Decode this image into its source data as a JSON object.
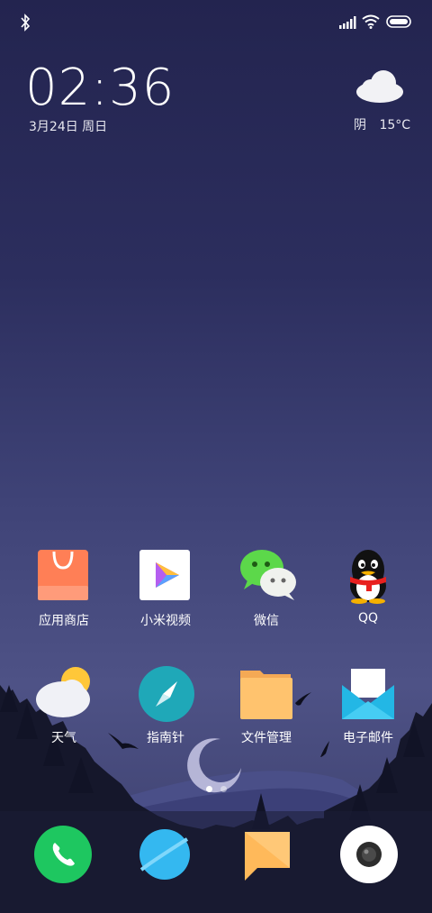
{
  "status_bar": {
    "icons": [
      "bluetooth-icon",
      "signal-icon",
      "wifi-icon",
      "battery-icon"
    ]
  },
  "clock": {
    "time": "02:36",
    "date": "3月24日 周日"
  },
  "weather": {
    "icon": "cloud-icon",
    "condition": "阴",
    "temperature": "15°C"
  },
  "apps": [
    {
      "label": "应用商店",
      "icon": "app-store-icon"
    },
    {
      "label": "小米视频",
      "icon": "video-icon"
    },
    {
      "label": "微信",
      "icon": "wechat-icon"
    },
    {
      "label": "QQ",
      "icon": "qq-icon"
    },
    {
      "label": "天气",
      "icon": "weather-app-icon"
    },
    {
      "label": "指南针",
      "icon": "compass-icon"
    },
    {
      "label": "文件管理",
      "icon": "file-manager-icon"
    },
    {
      "label": "电子邮件",
      "icon": "email-icon"
    }
  ],
  "page_indicator": {
    "pages": 2,
    "current": 1
  },
  "dock": [
    {
      "icon": "phone-icon"
    },
    {
      "icon": "browser-icon"
    },
    {
      "icon": "messages-icon"
    },
    {
      "icon": "camera-icon"
    }
  ]
}
